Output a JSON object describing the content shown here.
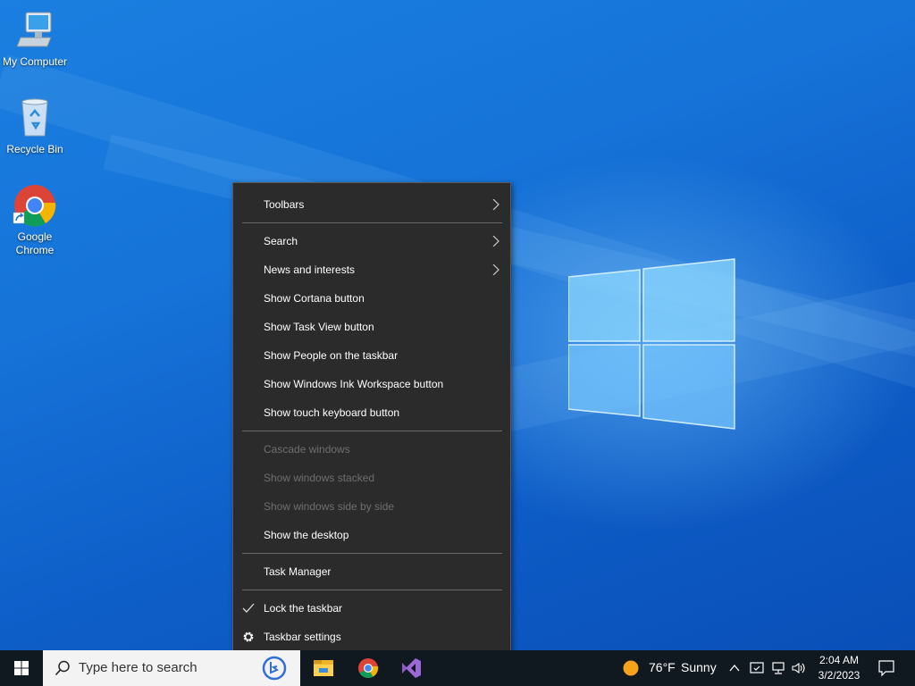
{
  "desktop": {
    "icons": [
      {
        "label": "My Computer"
      },
      {
        "label": "Recycle Bin"
      },
      {
        "label": "Google Chrome"
      }
    ]
  },
  "context_menu": {
    "items": [
      {
        "label": "Toolbars",
        "submenu": true
      },
      {
        "label": "Search",
        "submenu": true
      },
      {
        "label": "News and interests",
        "submenu": true
      },
      {
        "label": "Show Cortana button"
      },
      {
        "label": "Show Task View button"
      },
      {
        "label": "Show People on the taskbar"
      },
      {
        "label": "Show Windows Ink Workspace button"
      },
      {
        "label": "Show touch keyboard button"
      },
      {
        "label": "Cascade windows",
        "disabled": true
      },
      {
        "label": "Show windows stacked",
        "disabled": true
      },
      {
        "label": "Show windows side by side",
        "disabled": true
      },
      {
        "label": "Show the desktop"
      },
      {
        "label": "Task Manager"
      },
      {
        "label": "Lock the taskbar",
        "checked": true
      },
      {
        "label": "Taskbar settings",
        "icon": "gear-icon"
      }
    ]
  },
  "taskbar": {
    "search_placeholder": "Type here to search",
    "weather": {
      "temp": "76°F",
      "condition": "Sunny"
    },
    "clock": {
      "time": "2:04 AM",
      "date": "3/2/2023"
    },
    "colors": {
      "background": "#101820",
      "accent": "#76b9ed"
    }
  }
}
